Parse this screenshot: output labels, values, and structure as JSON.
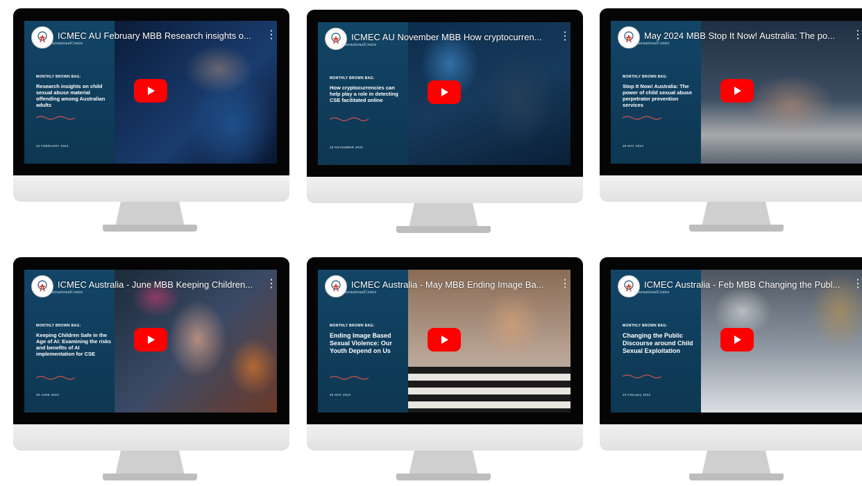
{
  "colors": {
    "bezel": "#050505",
    "chin": "#e6e6e6",
    "panel": "#124567",
    "youtube_red": "#ff0000"
  },
  "videos": [
    {
      "title": "ICMEC AU February MBB Research insights o...",
      "series_label": "MONTHLY BROWN BAG:",
      "talk_title": "Research insights on child sexual abuse material offending among Australian adults",
      "date": "22 FEBRUARY 2024"
    },
    {
      "title": "ICMEC AU November MBB How cryptocurren...",
      "series_label": "MONTHLY BROWN BAG:",
      "talk_title": "How cryptocurrencies can help play a role in detecting CSE facilitated online",
      "date": "28 NOVEMBER 2023"
    },
    {
      "title": "May 2024 MBB Stop It Now! Australia: The po...",
      "series_label": "MONTHLY BROWN BAG:",
      "talk_title": "Stop It Now! Australia: The power of child sexual abuse perpetrator prevention services",
      "date": "28 MAY 2024"
    },
    {
      "title": "ICMEC Australia - June MBB Keeping Children...",
      "series_label": "MONTHLY BROWN BAG:",
      "talk_title": "Keeping Children Safe in the Age of AI: Examining the risks and benefits of AI implementation for CSE",
      "date": "29 JUNE 2023"
    },
    {
      "title": "ICMEC Australia - May MBB Ending Image Ba...",
      "series_label": "MONTHLY BROWN BAG:",
      "talk_title": "Ending Image Based Sexual Violence: Our Youth Depend on Us",
      "date": "25 MAY 2023"
    },
    {
      "title": "ICMEC Australia - Feb MBB Changing the Publ...",
      "series_label": "MONTHLY BROWN BAG:",
      "talk_title": "Changing the Public Discourse around Child Sexual Exploitation",
      "date": "23 February 2023"
    }
  ],
  "logo_caption": "InternationalCentre"
}
